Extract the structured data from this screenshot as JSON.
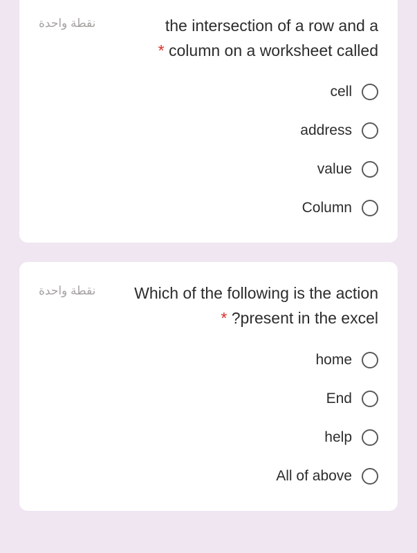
{
  "questions": [
    {
      "points": "نقطة واحدة",
      "text_line1": "the intersection of a row and a",
      "text_line2": "column on a worksheet called",
      "required": "*",
      "options": [
        "cell",
        "address",
        "value",
        "Column"
      ]
    },
    {
      "points": "نقطة واحدة",
      "text_line1": "Which of the following is the action",
      "text_line2": "?present in the excel",
      "required": "*",
      "options": [
        "home",
        "End",
        "help",
        "All of above"
      ]
    }
  ]
}
